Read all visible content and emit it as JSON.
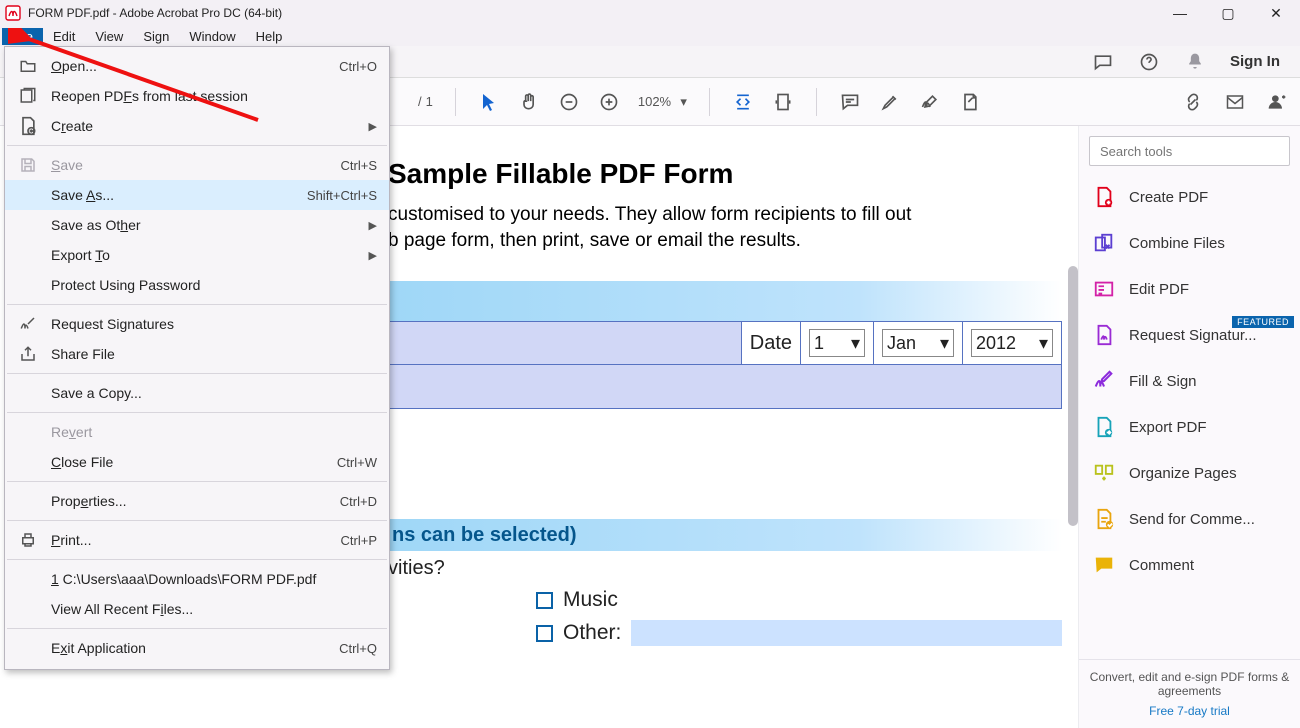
{
  "title": "FORM PDF.pdf - Adobe Acrobat Pro DC (64-bit)",
  "menubar": {
    "file": "File",
    "edit": "Edit",
    "view": "View",
    "sign": "Sign",
    "window": "Window",
    "help": "Help"
  },
  "toolstrip": {
    "signin": "Sign In"
  },
  "toolbar2": {
    "page_sep": "/",
    "page_total": "1",
    "zoom": "102%"
  },
  "file_menu": {
    "open": "Open...",
    "open_k": "Ctrl+O",
    "reopen": "Reopen PDFs from last session",
    "create": "Create",
    "save": "Save",
    "save_k": "Ctrl+S",
    "saveas": "Save As...",
    "saveas_k": "Shift+Ctrl+S",
    "saveother": "Save as Other",
    "export": "Export To",
    "protect": "Protect Using Password",
    "reqsig": "Request Signatures",
    "share": "Share File",
    "savecopy": "Save a Copy...",
    "revert": "Revert",
    "close": "Close File",
    "close_k": "Ctrl+W",
    "props": "Properties...",
    "props_k": "Ctrl+D",
    "print": "Print...",
    "print_k": "Ctrl+P",
    "recent1": "1 C:\\Users\\aaa\\Downloads\\FORM PDF.pdf",
    "recentall": "View All Recent Files...",
    "exit": "Exit Application",
    "exit_k": "Ctrl+Q"
  },
  "right": {
    "search_ph": "Search tools",
    "tools": {
      "create": "Create PDF",
      "combine": "Combine Files",
      "edit": "Edit PDF",
      "reqsig": "Request Signatur...",
      "reqsig_badge": "FEATURED",
      "fill": "Fill & Sign",
      "export": "Export PDF",
      "organize": "Organize Pages",
      "send": "Send for Comme...",
      "comment": "Comment"
    },
    "footer1": "Convert, edit and e-sign PDF forms & agreements",
    "footer2": "Free 7-day trial"
  },
  "doc": {
    "h1": "Sample Fillable PDF Form",
    "p1a": "customised to your needs. They allow form recipients to fill out",
    "p1b": "b page form, then print, save or email the results.",
    "date_lbl": "Date",
    "day": "1",
    "mon": "Jan",
    "year": "2012",
    "sec2": "ns can be selected)",
    "q": "vities?",
    "opt1": "Music",
    "opt2": "Other:"
  }
}
